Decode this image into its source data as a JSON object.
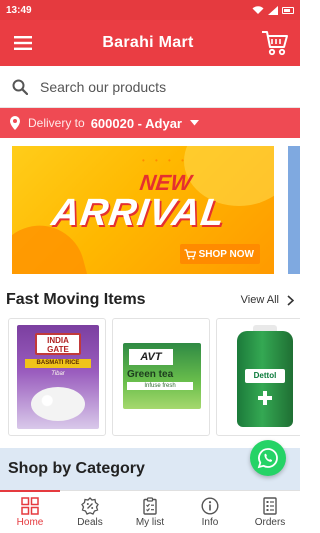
{
  "status_bar": {
    "time": "13:49"
  },
  "app_bar": {
    "title": "Barahi Mart",
    "menu_icon": "hamburger-menu-icon",
    "cart_icon": "shopping-cart-icon"
  },
  "search": {
    "placeholder": "Search our products",
    "icon": "search-icon"
  },
  "delivery": {
    "label": "Delivery to",
    "location": "600020 - Adyar",
    "icon": "location-pin-icon"
  },
  "banner": {
    "headline_top": "NEW",
    "headline_main": "ARRIVAL",
    "cta": "SHOP NOW"
  },
  "fast_moving": {
    "heading": "Fast Moving Items",
    "view_all": "View All",
    "products": [
      {
        "brand_text": "INDIA GATE",
        "subtitle": "BASMATI RICE",
        "variant": "Tibar"
      },
      {
        "brand_text": "AVT",
        "subtitle": "Green tea",
        "variant": "Infuse fresh"
      },
      {
        "brand_text": "Dettol"
      }
    ]
  },
  "shop_by_category": {
    "heading": "Shop by Category"
  },
  "bottom_nav": {
    "items": [
      {
        "label": "Home",
        "icon": "grid-home-icon",
        "active": true
      },
      {
        "label": "Deals",
        "icon": "deals-badge-icon",
        "active": false
      },
      {
        "label": "My list",
        "icon": "clipboard-list-icon",
        "active": false
      },
      {
        "label": "Info",
        "icon": "info-icon",
        "active": false
      },
      {
        "label": "Orders",
        "icon": "orders-receipt-icon",
        "active": false
      }
    ]
  },
  "colors": {
    "brand_red": "#ea3d43",
    "delivery_red": "#ef4a53",
    "category_bg": "#dde8f4",
    "whatsapp_green": "#25d366"
  }
}
